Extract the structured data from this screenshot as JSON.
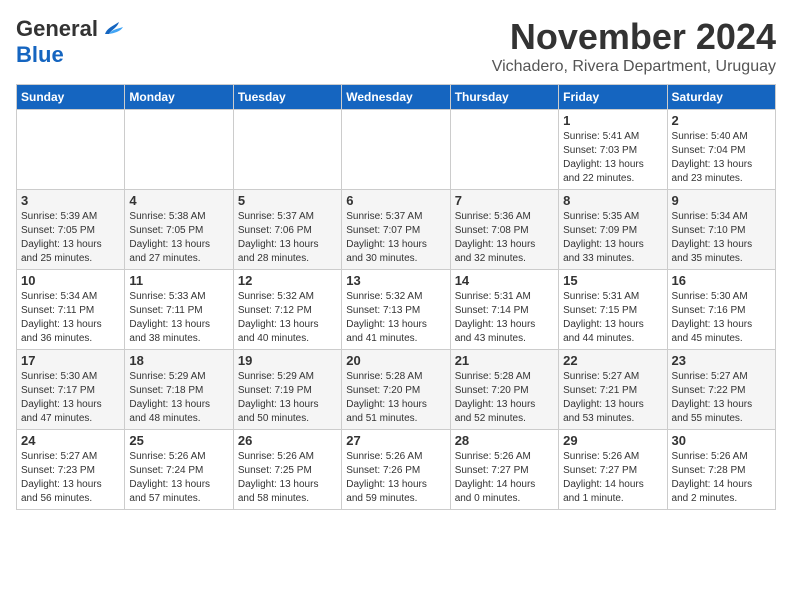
{
  "header": {
    "logo_general": "General",
    "logo_blue": "Blue",
    "month_title": "November 2024",
    "location": "Vichadero, Rivera Department, Uruguay"
  },
  "days_of_week": [
    "Sunday",
    "Monday",
    "Tuesday",
    "Wednesday",
    "Thursday",
    "Friday",
    "Saturday"
  ],
  "weeks": [
    [
      {
        "day": "",
        "info": ""
      },
      {
        "day": "",
        "info": ""
      },
      {
        "day": "",
        "info": ""
      },
      {
        "day": "",
        "info": ""
      },
      {
        "day": "",
        "info": ""
      },
      {
        "day": "1",
        "info": "Sunrise: 5:41 AM\nSunset: 7:03 PM\nDaylight: 13 hours\nand 22 minutes."
      },
      {
        "day": "2",
        "info": "Sunrise: 5:40 AM\nSunset: 7:04 PM\nDaylight: 13 hours\nand 23 minutes."
      }
    ],
    [
      {
        "day": "3",
        "info": "Sunrise: 5:39 AM\nSunset: 7:05 PM\nDaylight: 13 hours\nand 25 minutes."
      },
      {
        "day": "4",
        "info": "Sunrise: 5:38 AM\nSunset: 7:05 PM\nDaylight: 13 hours\nand 27 minutes."
      },
      {
        "day": "5",
        "info": "Sunrise: 5:37 AM\nSunset: 7:06 PM\nDaylight: 13 hours\nand 28 minutes."
      },
      {
        "day": "6",
        "info": "Sunrise: 5:37 AM\nSunset: 7:07 PM\nDaylight: 13 hours\nand 30 minutes."
      },
      {
        "day": "7",
        "info": "Sunrise: 5:36 AM\nSunset: 7:08 PM\nDaylight: 13 hours\nand 32 minutes."
      },
      {
        "day": "8",
        "info": "Sunrise: 5:35 AM\nSunset: 7:09 PM\nDaylight: 13 hours\nand 33 minutes."
      },
      {
        "day": "9",
        "info": "Sunrise: 5:34 AM\nSunset: 7:10 PM\nDaylight: 13 hours\nand 35 minutes."
      }
    ],
    [
      {
        "day": "10",
        "info": "Sunrise: 5:34 AM\nSunset: 7:11 PM\nDaylight: 13 hours\nand 36 minutes."
      },
      {
        "day": "11",
        "info": "Sunrise: 5:33 AM\nSunset: 7:11 PM\nDaylight: 13 hours\nand 38 minutes."
      },
      {
        "day": "12",
        "info": "Sunrise: 5:32 AM\nSunset: 7:12 PM\nDaylight: 13 hours\nand 40 minutes."
      },
      {
        "day": "13",
        "info": "Sunrise: 5:32 AM\nSunset: 7:13 PM\nDaylight: 13 hours\nand 41 minutes."
      },
      {
        "day": "14",
        "info": "Sunrise: 5:31 AM\nSunset: 7:14 PM\nDaylight: 13 hours\nand 43 minutes."
      },
      {
        "day": "15",
        "info": "Sunrise: 5:31 AM\nSunset: 7:15 PM\nDaylight: 13 hours\nand 44 minutes."
      },
      {
        "day": "16",
        "info": "Sunrise: 5:30 AM\nSunset: 7:16 PM\nDaylight: 13 hours\nand 45 minutes."
      }
    ],
    [
      {
        "day": "17",
        "info": "Sunrise: 5:30 AM\nSunset: 7:17 PM\nDaylight: 13 hours\nand 47 minutes."
      },
      {
        "day": "18",
        "info": "Sunrise: 5:29 AM\nSunset: 7:18 PM\nDaylight: 13 hours\nand 48 minutes."
      },
      {
        "day": "19",
        "info": "Sunrise: 5:29 AM\nSunset: 7:19 PM\nDaylight: 13 hours\nand 50 minutes."
      },
      {
        "day": "20",
        "info": "Sunrise: 5:28 AM\nSunset: 7:20 PM\nDaylight: 13 hours\nand 51 minutes."
      },
      {
        "day": "21",
        "info": "Sunrise: 5:28 AM\nSunset: 7:20 PM\nDaylight: 13 hours\nand 52 minutes."
      },
      {
        "day": "22",
        "info": "Sunrise: 5:27 AM\nSunset: 7:21 PM\nDaylight: 13 hours\nand 53 minutes."
      },
      {
        "day": "23",
        "info": "Sunrise: 5:27 AM\nSunset: 7:22 PM\nDaylight: 13 hours\nand 55 minutes."
      }
    ],
    [
      {
        "day": "24",
        "info": "Sunrise: 5:27 AM\nSunset: 7:23 PM\nDaylight: 13 hours\nand 56 minutes."
      },
      {
        "day": "25",
        "info": "Sunrise: 5:26 AM\nSunset: 7:24 PM\nDaylight: 13 hours\nand 57 minutes."
      },
      {
        "day": "26",
        "info": "Sunrise: 5:26 AM\nSunset: 7:25 PM\nDaylight: 13 hours\nand 58 minutes."
      },
      {
        "day": "27",
        "info": "Sunrise: 5:26 AM\nSunset: 7:26 PM\nDaylight: 13 hours\nand 59 minutes."
      },
      {
        "day": "28",
        "info": "Sunrise: 5:26 AM\nSunset: 7:27 PM\nDaylight: 14 hours\nand 0 minutes."
      },
      {
        "day": "29",
        "info": "Sunrise: 5:26 AM\nSunset: 7:27 PM\nDaylight: 14 hours\nand 1 minute."
      },
      {
        "day": "30",
        "info": "Sunrise: 5:26 AM\nSunset: 7:28 PM\nDaylight: 14 hours\nand 2 minutes."
      }
    ]
  ]
}
